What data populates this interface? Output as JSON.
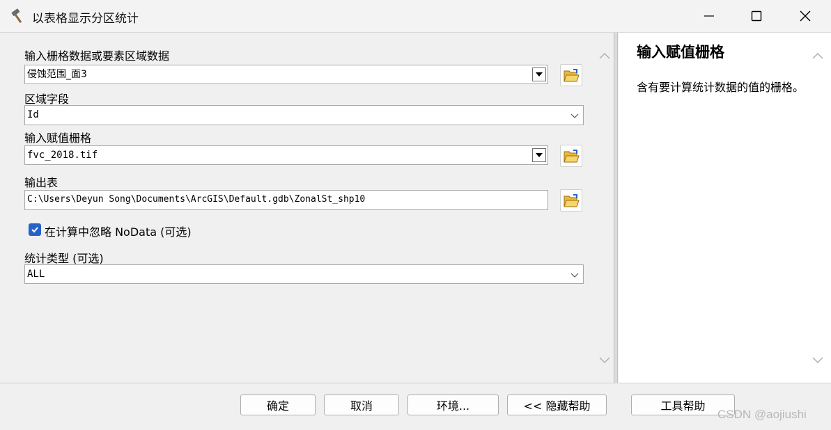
{
  "window": {
    "title": "以表格显示分区统计",
    "icon": "hammer-icon"
  },
  "form": {
    "input_zone_label": "输入栅格数据或要素区域数据",
    "input_zone_value": "侵蚀范围_面3",
    "zone_field_label": "区域字段",
    "zone_field_value": "Id",
    "value_raster_label": "输入赋值栅格",
    "value_raster_value": "fvc_2018.tif",
    "output_table_label": "输出表",
    "output_table_value": "C:\\Users\\Deyun Song\\Documents\\ArcGIS\\Default.gdb\\ZonalSt_shp10",
    "ignore_nodata_label": "在计算中忽略 NoData (可选)",
    "ignore_nodata_checked": true,
    "statistics_type_label": "统计类型 (可选)",
    "statistics_type_value": "ALL"
  },
  "help": {
    "title": "输入赋值栅格",
    "text": "含有要计算统计数据的值的栅格。"
  },
  "buttons": {
    "ok": "确定",
    "cancel": "取消",
    "environments": "环境...",
    "hide_help": "<< 隐藏帮助",
    "tool_help": "工具帮助"
  },
  "watermark": "CSDN @aojiushi"
}
